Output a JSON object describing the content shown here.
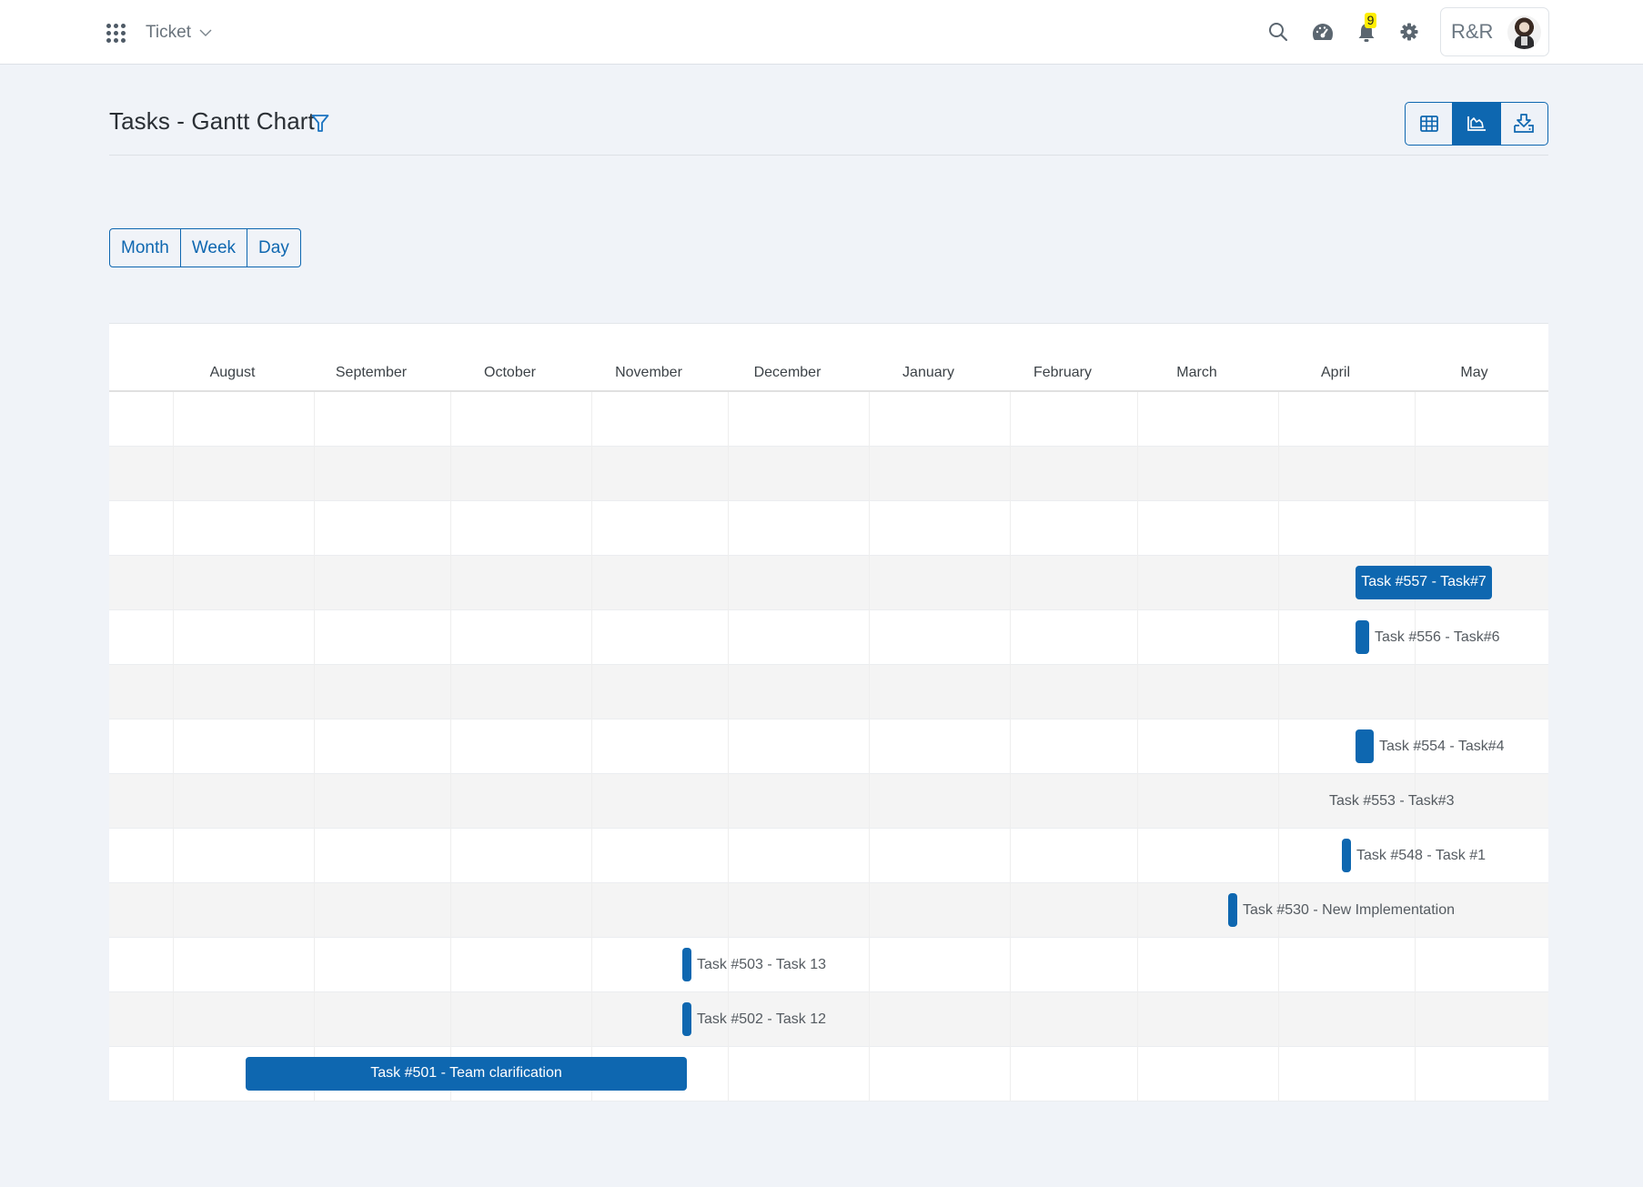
{
  "header": {
    "module": "Ticket",
    "notification_count": "9",
    "user_initials": "R&R",
    "icons": {
      "apps": "apps-grid-icon",
      "search": "search-icon",
      "dashboard": "speedometer-icon",
      "notifications": "bell-icon",
      "settings": "gear-icon"
    }
  },
  "page": {
    "title": "Tasks - Gantt Chart",
    "views": [
      {
        "name": "table-view",
        "icon": "table-icon",
        "active": false
      },
      {
        "name": "gantt-view",
        "icon": "chart-area-icon",
        "active": true
      },
      {
        "name": "export",
        "icon": "download-tray-icon",
        "active": false
      }
    ],
    "scale_buttons": [
      "Month",
      "Week",
      "Day"
    ]
  },
  "colors": {
    "accent": "#0e67b0",
    "badge": "#ffee00",
    "row_alt": "#f4f4f4",
    "background": "#f0f3f8"
  },
  "chart_data": {
    "type": "gantt",
    "title": "Tasks - Gantt Chart",
    "scale": "Month",
    "timeline_months": [
      "August",
      "September",
      "October",
      "November",
      "December",
      "January",
      "February",
      "March",
      "April",
      "May"
    ],
    "timeline_start": "Jul 18",
    "rows": [
      {
        "task": "",
        "start": null,
        "end": null
      },
      {
        "task": "",
        "start": null,
        "end": null
      },
      {
        "task": "",
        "start": null,
        "end": null
      },
      {
        "task": "Task #557 - Task#7",
        "start": "Apr 18",
        "end": "May 18",
        "label_inside": true
      },
      {
        "task": "Task #556 - Task#6",
        "start": "Apr 18",
        "end": "Apr 21"
      },
      {
        "task": "",
        "start": null,
        "end": null
      },
      {
        "task": "Task #554 - Task#4",
        "start": "Apr 18",
        "end": "Apr 22"
      },
      {
        "task": "Task #553 - Task#3",
        "start": null,
        "end": null,
        "label_only": true
      },
      {
        "task": "Task #548 - Task #1",
        "start": "Apr 15",
        "end": "Apr 17"
      },
      {
        "task": "Task #530 - New Implementation",
        "start": "Mar 21",
        "end": "Mar 23"
      },
      {
        "task": "Task #503 - Task 13",
        "start": "Nov 21",
        "end": "Nov 23"
      },
      {
        "task": "Task #502 - Task 12",
        "start": "Nov 21",
        "end": "Nov 23"
      },
      {
        "task": "Task #501 - Team clarification",
        "start": "Aug 17",
        "end": "Nov 22",
        "label_inside": true
      }
    ]
  }
}
